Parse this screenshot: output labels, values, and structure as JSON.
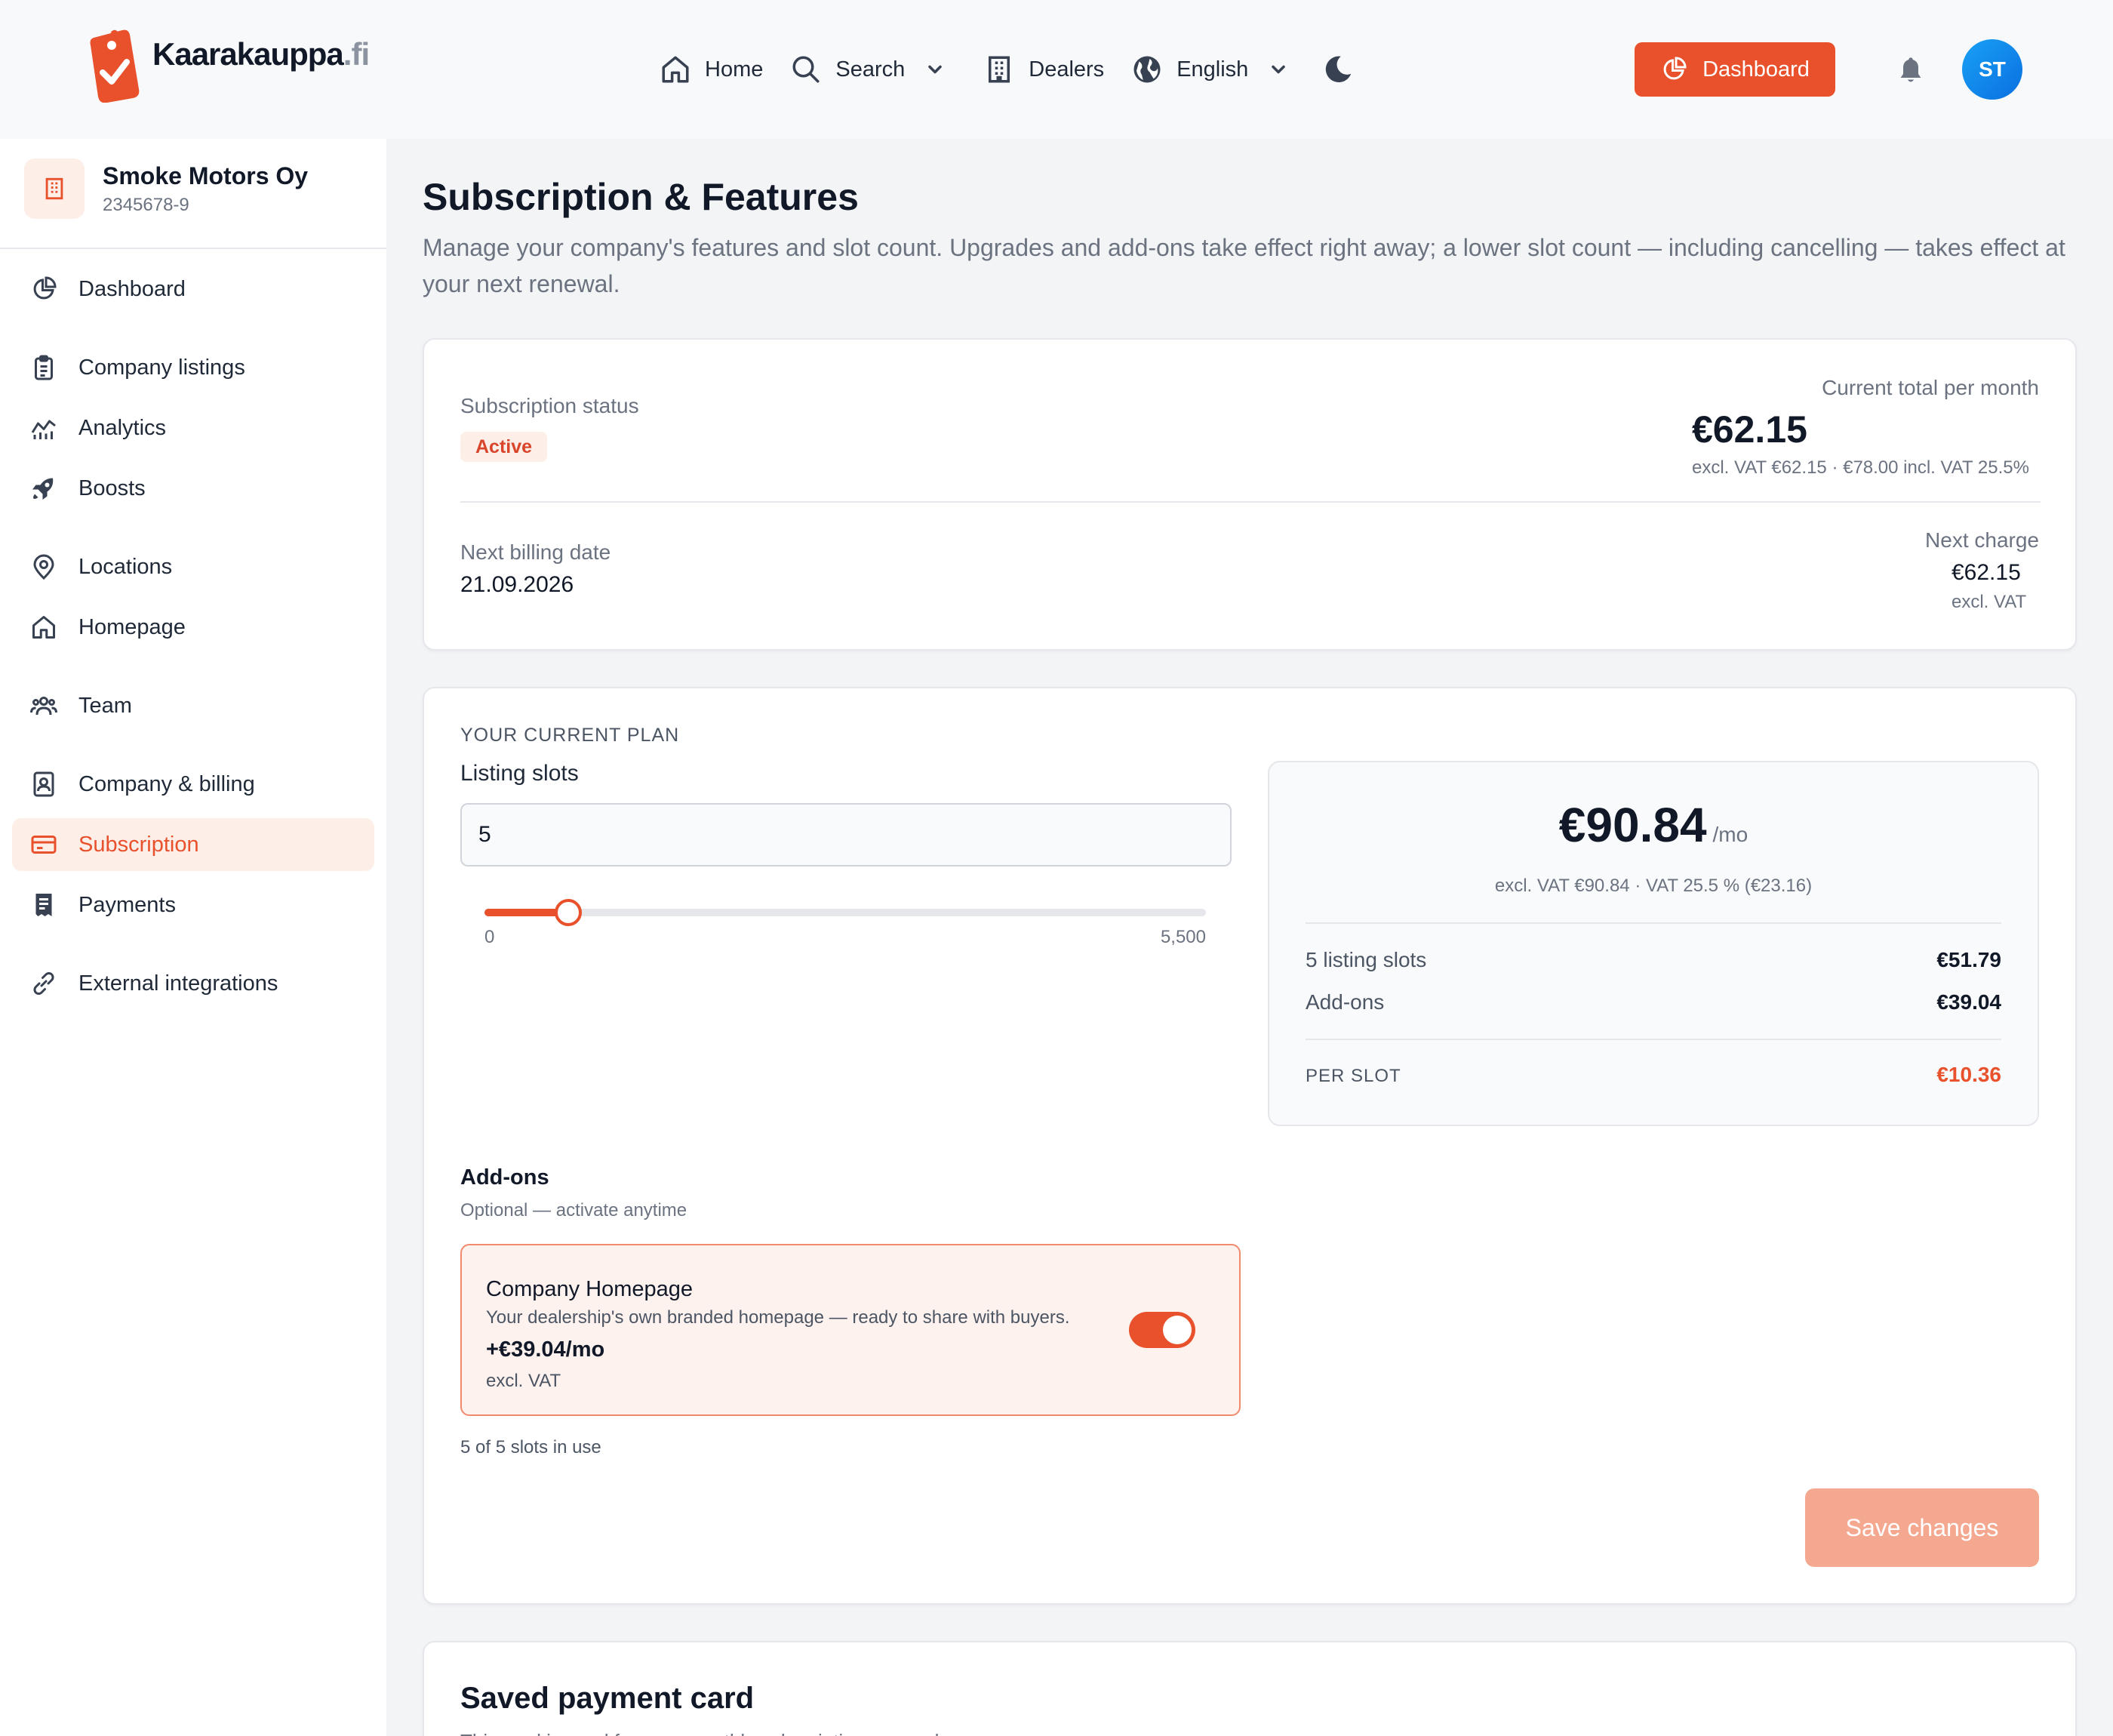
{
  "brand": {
    "name": "Kaarakauppa",
    "tld": ".fi"
  },
  "nav": {
    "home": "Home",
    "search": "Search",
    "dealers": "Dealers",
    "language": "English",
    "dashboard_button": "Dashboard",
    "avatar_initials": "ST"
  },
  "company": {
    "name": "Smoke Motors Oy",
    "business_id": "2345678-9"
  },
  "sidebar": {
    "items": [
      {
        "label": "Dashboard",
        "icon": "pie-chart-icon"
      },
      {
        "label": "Company listings",
        "icon": "clipboard-icon"
      },
      {
        "label": "Analytics",
        "icon": "line-chart-icon"
      },
      {
        "label": "Boosts",
        "icon": "rocket-icon"
      },
      {
        "label": "Locations",
        "icon": "map-pin-icon"
      },
      {
        "label": "Homepage",
        "icon": "home-icon"
      },
      {
        "label": "Team",
        "icon": "users-icon"
      },
      {
        "label": "Company & billing",
        "icon": "contact-book-icon"
      },
      {
        "label": "Subscription",
        "icon": "credit-card-icon",
        "active": true
      },
      {
        "label": "Payments",
        "icon": "receipt-icon"
      },
      {
        "label": "External integrations",
        "icon": "link-icon"
      }
    ]
  },
  "page": {
    "title": "Subscription & Features",
    "description": "Manage your company's features and slot count. Upgrades and add-ons take effect right away; a lower slot count — including cancelling — takes effect at your next renewal."
  },
  "status": {
    "label": "Subscription status",
    "badge": "Active",
    "total_label": "Current total per month",
    "total_value": "€62.15",
    "total_note": "excl. VAT €62.15 · €78.00 incl. VAT 25.5%",
    "billing_label": "Next billing date",
    "billing_date": "21.09.2026",
    "charge_label": "Next charge",
    "charge_value": "€62.15",
    "charge_note": "excl. VAT"
  },
  "plan": {
    "eyebrow": "YOUR CURRENT PLAN",
    "slots_label": "Listing slots",
    "slots_value": "5",
    "slider": {
      "min": 0,
      "max": 5500,
      "value": 5,
      "min_label": "0",
      "max_label": "5,500"
    },
    "price": "€90.84",
    "price_unit": "/mo",
    "price_vat": "excl. VAT €90.84 · VAT 25.5 % (€23.16)",
    "rows": [
      {
        "label": "5 listing slots",
        "value": "€51.79"
      },
      {
        "label": "Add-ons",
        "value": "€39.04"
      }
    ],
    "per_slot_label": "PER SLOT",
    "per_slot_value": "€10.36",
    "addons_title": "Add-ons",
    "addons_subtitle": "Optional — activate anytime",
    "addon": {
      "name": "Company Homepage",
      "description": "Your dealership's own branded homepage — ready to share with buyers.",
      "price": "+€39.04/mo",
      "vat": "excl. VAT",
      "enabled": true
    },
    "slots_in_use": "5 of 5 slots in use",
    "save_label": "Save changes"
  },
  "payment_card": {
    "title": "Saved payment card",
    "subtitle": "This card is used for your monthly subscription renewals."
  },
  "colors": {
    "accent": "#e8512b",
    "accent_soft": "#fdeee8",
    "avatar": "#1590ee"
  }
}
